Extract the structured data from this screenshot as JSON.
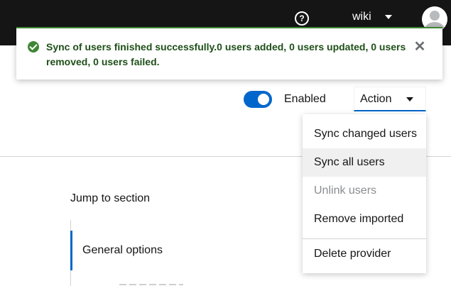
{
  "header": {
    "help_glyph": "?",
    "help_icon": "question-circle-icon",
    "realm_name": "wiki",
    "avatar_icon": "user-avatar-icon"
  },
  "alert": {
    "variant": "success",
    "color": "#3e8635",
    "icon": "check-circle-icon",
    "message": "Sync of users finished successfully.0 users added, 0 users updated, 0 users removed, 0 users failed.",
    "close_glyph": "✕"
  },
  "toolbar": {
    "enabled_label": "Enabled",
    "enabled_state": true,
    "toggle_color": "#0066cc",
    "action_label": "Action"
  },
  "action_menu": {
    "items": [
      {
        "label": "Sync changed users",
        "state": "normal"
      },
      {
        "label": "Sync all users",
        "state": "hover"
      },
      {
        "label": "Unlink users",
        "state": "disabled"
      },
      {
        "label": "Remove imported",
        "state": "normal"
      },
      {
        "label": "Delete provider",
        "state": "normal"
      }
    ]
  },
  "jump_nav": {
    "title": "Jump to section",
    "active_item": "General options"
  }
}
